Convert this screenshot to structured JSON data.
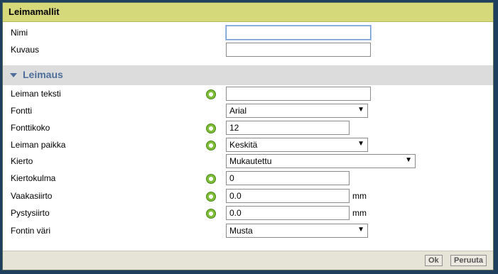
{
  "dialog": {
    "title": "Leimamallit"
  },
  "top_fields": [
    {
      "label": "Nimi",
      "value": ""
    },
    {
      "label": "Kuvaus",
      "value": ""
    }
  ],
  "section": {
    "title": "Leimaus"
  },
  "stamp": {
    "text": {
      "label": "Leiman teksti",
      "value": ""
    },
    "font": {
      "label": "Fontti",
      "selected": "Arial"
    },
    "size": {
      "label": "Fonttikoko",
      "value": "12"
    },
    "position": {
      "label": "Leiman paikka",
      "selected": "Keskitä"
    },
    "rotation": {
      "label": "Kierto",
      "selected": "Mukautettu"
    },
    "angle": {
      "label": "Kiertokulma",
      "value": "0"
    },
    "hshift": {
      "label": "Vaakasiirto",
      "value": "0.0",
      "unit": "mm"
    },
    "vshift": {
      "label": "Pystysiirto",
      "value": "0.0",
      "unit": "mm"
    },
    "color": {
      "label": "Fontin väri",
      "selected": "Musta"
    }
  },
  "footer": {
    "ok": "Ok",
    "cancel": "Peruuta"
  },
  "icons": {
    "hint": "info-hint-icon",
    "dropdown": "chevron-down-icon"
  },
  "colors": {
    "titlebar": "#d6d97a",
    "section_title": "#4d6e9a",
    "hint": "#7fbd3a"
  }
}
